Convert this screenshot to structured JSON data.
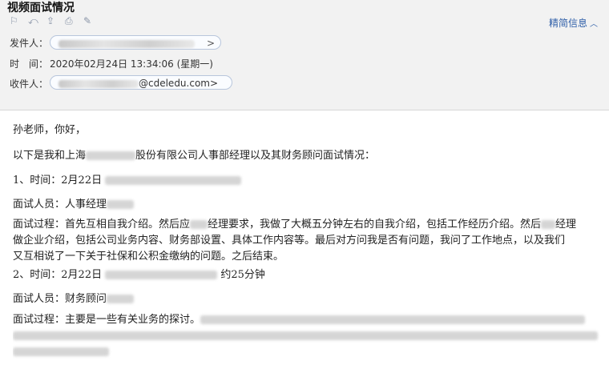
{
  "subject": "视频面试情况",
  "toolbar": {
    "icons": [
      "flag-icon",
      "reply-icon",
      "forward-icon",
      "print-icon",
      "edit-icon"
    ]
  },
  "header": {
    "details_link": "精简信息",
    "sender_label": "发件人：",
    "sender_suffix": ">",
    "time_label": "时　间：",
    "time_value": "2020年02月24日 13:34:06 (星期一)",
    "recipient_label": "收件人：",
    "recipient_value": "s…cdeledu.com>",
    "recipient_visible": "@cdeledu.com>"
  },
  "body": {
    "greeting": "孙老师，你好，",
    "intro_a": "以下是我和上海",
    "intro_b": "股份有限公司人事部经理以及其财务顾问面试情况：",
    "item1_time": "1、时间：2月22日",
    "item1_interviewer": "面试人员：人事经理",
    "item1_process_1a": "面试过程：首先互相自我介绍。然后应",
    "item1_process_1b": "经理要求，我做了大概五分钟左右的自我介绍，包括工作经历介绍。然后",
    "item1_process_1c": "经理",
    "item1_process_2": "做企业介绍，包括公司业务内容、财务部设置、具体工作内容等。最后对方问我是否有问题，我问了工作地点，以及我们",
    "item1_process_3": "又互相说了一下关于社保和公积金缴纳的问题。之后结束。",
    "item2_time_a": "2、时间：2月22日",
    "item2_time_b": "约25分钟",
    "item2_interviewer": "面试人员：财务顾问",
    "item2_process_a": "面试过程：主要是一些有关业务的探讨。"
  }
}
